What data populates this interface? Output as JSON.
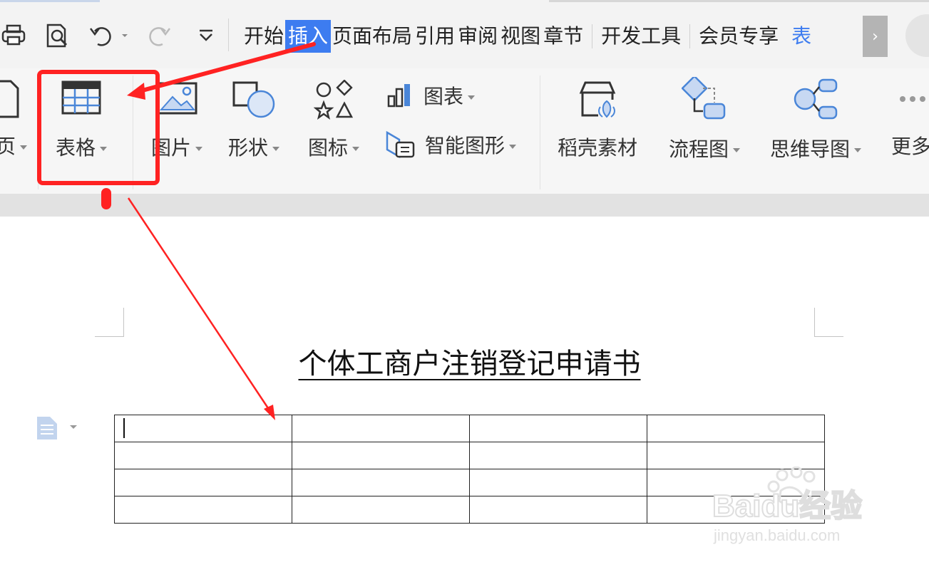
{
  "menu": {
    "tabs": [
      {
        "label": "开始",
        "active": false
      },
      {
        "label": "插入",
        "active": true
      },
      {
        "label": "页面布局",
        "active": false
      },
      {
        "label": "引用",
        "active": false
      },
      {
        "label": "审阅",
        "active": false
      },
      {
        "label": "视图",
        "active": false
      },
      {
        "label": "章节",
        "active": false
      },
      {
        "label": "开发工具",
        "active": false
      },
      {
        "label": "会员专享",
        "active": false
      },
      {
        "label": "表",
        "active": false
      }
    ],
    "scroll_right": "›"
  },
  "quick_access": {
    "icons": [
      "print-icon",
      "print-preview-icon",
      "undo-icon",
      "redo-icon",
      "customize-icon"
    ]
  },
  "ribbon": {
    "left_partial_label": "页",
    "table_label": "表格",
    "picture_label": "图片",
    "shape_label": "形状",
    "icon_label": "图标",
    "chart_label": "图表",
    "smart_graphic_label": "智能图形",
    "material_label": "稻壳素材",
    "flowchart_label": "流程图",
    "mindmap_label": "思维导图",
    "more_label": "更多"
  },
  "document": {
    "title": "个体工商户注销登记申请书",
    "table": {
      "rows": 4,
      "cols": 4
    }
  },
  "watermark": {
    "brand": "Baidu经验",
    "url": "jingyan.baidu.com"
  },
  "colors": {
    "accent_blue": "#3d7cf0",
    "annotation_red": "#ff2222",
    "icon_blue": "#4a86d8"
  }
}
